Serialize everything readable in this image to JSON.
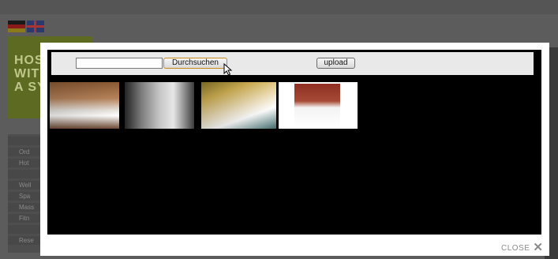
{
  "background": {
    "banner_lines": [
      "HOSP",
      "WITE",
      "A SY"
    ],
    "sidebar_items": [
      "",
      "Ord",
      "Hot",
      "",
      "Well",
      "Spa",
      "Mass",
      "Fitn",
      "",
      "Rese"
    ]
  },
  "modal": {
    "browse_label": "Durchsuchen",
    "upload_label": "upload",
    "file_value": "",
    "close_label": "CLOSE"
  },
  "thumbnails": [
    {
      "name": "bathroom-thumbnail"
    },
    {
      "name": "lounge-thumbnail"
    },
    {
      "name": "hotel-room-thumbnail"
    },
    {
      "name": "bedroom-thumbnail"
    }
  ],
  "colors": {
    "overlay": "#5c5c5c",
    "modal_bg": "#ffffff",
    "gallery_bg": "#000000",
    "toolbar_bg": "#e9e9e9",
    "banner": "#5d6a21"
  }
}
